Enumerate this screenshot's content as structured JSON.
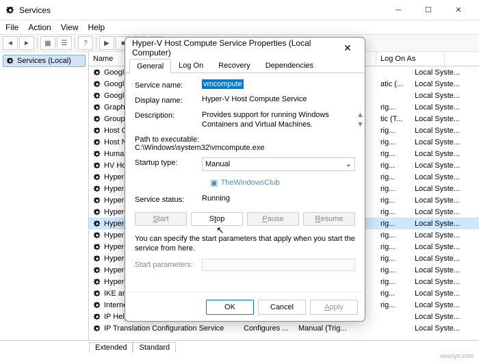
{
  "window": {
    "title": "Services"
  },
  "menu": {
    "file": "File",
    "action": "Action",
    "view": "View",
    "help": "Help"
  },
  "tree": {
    "root": "Services (Local)"
  },
  "columns": {
    "name": "Name",
    "logon": "Log On As"
  },
  "rows": [
    {
      "name": "Google Chr...",
      "mid": "",
      "logon": "Local Syste..."
    },
    {
      "name": "Google Up...",
      "mid": "atic (...",
      "logon": "Local Syste..."
    },
    {
      "name": "Google Up...",
      "mid": "",
      "logon": "Local Syste..."
    },
    {
      "name": "GraphicsPe...",
      "mid": "rig...",
      "logon": "Local Syste..."
    },
    {
      "name": "Group Polic...",
      "mid": "tic (T...",
      "logon": "Local Syste..."
    },
    {
      "name": "Host Guard...",
      "mid": "rig...",
      "logon": "Local Syste..."
    },
    {
      "name": "Host Netwo...",
      "mid": "rig...",
      "logon": "Local Syste..."
    },
    {
      "name": "Human Inte...",
      "mid": "rig...",
      "logon": "Local Syste..."
    },
    {
      "name": "HV Host Se...",
      "mid": "rig...",
      "logon": "Local Syste..."
    },
    {
      "name": "Hyper-V Da...",
      "mid": "rig...",
      "logon": "Local Syste..."
    },
    {
      "name": "Hyper-V Gu...",
      "mid": "rig...",
      "logon": "Local Syste..."
    },
    {
      "name": "Hyper-V Gu...",
      "mid": "rig...",
      "logon": "Local Syste..."
    },
    {
      "name": "Hyper-V He...",
      "mid": "rig...",
      "logon": "Local Syste..."
    },
    {
      "name": "Hyper-V Ho...",
      "mid": "rig...",
      "logon": "Local Syste...",
      "selected": true
    },
    {
      "name": "Hyper-V Po...",
      "mid": "rig...",
      "logon": "Local Syste..."
    },
    {
      "name": "Hyper-V Re...",
      "mid": "rig...",
      "logon": "Local Syste..."
    },
    {
      "name": "Hyper-V Ti...",
      "mid": "rig...",
      "logon": "Local Syste..."
    },
    {
      "name": "Hyper-V Vir...",
      "mid": "rig...",
      "logon": "Local Syste..."
    },
    {
      "name": "Hyper-V Vo...",
      "mid": "rig...",
      "logon": "Local Syste..."
    },
    {
      "name": "IKE and Au...",
      "mid": "rig...",
      "logon": "Local Syste..."
    },
    {
      "name": "Internet Co...",
      "mid": "rig...",
      "logon": "Local Syste..."
    },
    {
      "name": "IP Helper",
      "mid": "",
      "logon": "Local Syste..."
    }
  ],
  "last_row": {
    "name": "IP Translation Configuration Service",
    "desc": "Configures ...",
    "start": "Manual (Trig...",
    "logon": "Local Syste..."
  },
  "bottom_tabs": {
    "extended": "Extended",
    "standard": "Standard"
  },
  "footer": "wsxsys.com",
  "dialog": {
    "title": "Hyper-V Host Compute Service Properties (Local Computer)",
    "tabs": {
      "general": "General",
      "logon": "Log On",
      "recovery": "Recovery",
      "deps": "Dependencies"
    },
    "service_name_label": "Service name:",
    "service_name": "vmcompute",
    "display_name_label": "Display name:",
    "display_name": "Hyper-V Host Compute Service",
    "description_label": "Description:",
    "description": "Provides support for running Windows Containers and Virtual Machines.",
    "path_label": "Path to executable:",
    "path": "C:\\Windows\\system32\\vmcompute.exe",
    "startup_label": "Startup type:",
    "startup_value": "Manual",
    "watermark": "TheWindowsClub",
    "status_label": "Service status:",
    "status": "Running",
    "btn_start": "Start",
    "btn_stop": "Stop",
    "btn_pause": "Pause",
    "btn_resume": "Resume",
    "note": "You can specify the start parameters that apply when you start the service from here.",
    "params_label": "Start parameters:",
    "ok": "OK",
    "cancel": "Cancel",
    "apply": "Apply"
  }
}
